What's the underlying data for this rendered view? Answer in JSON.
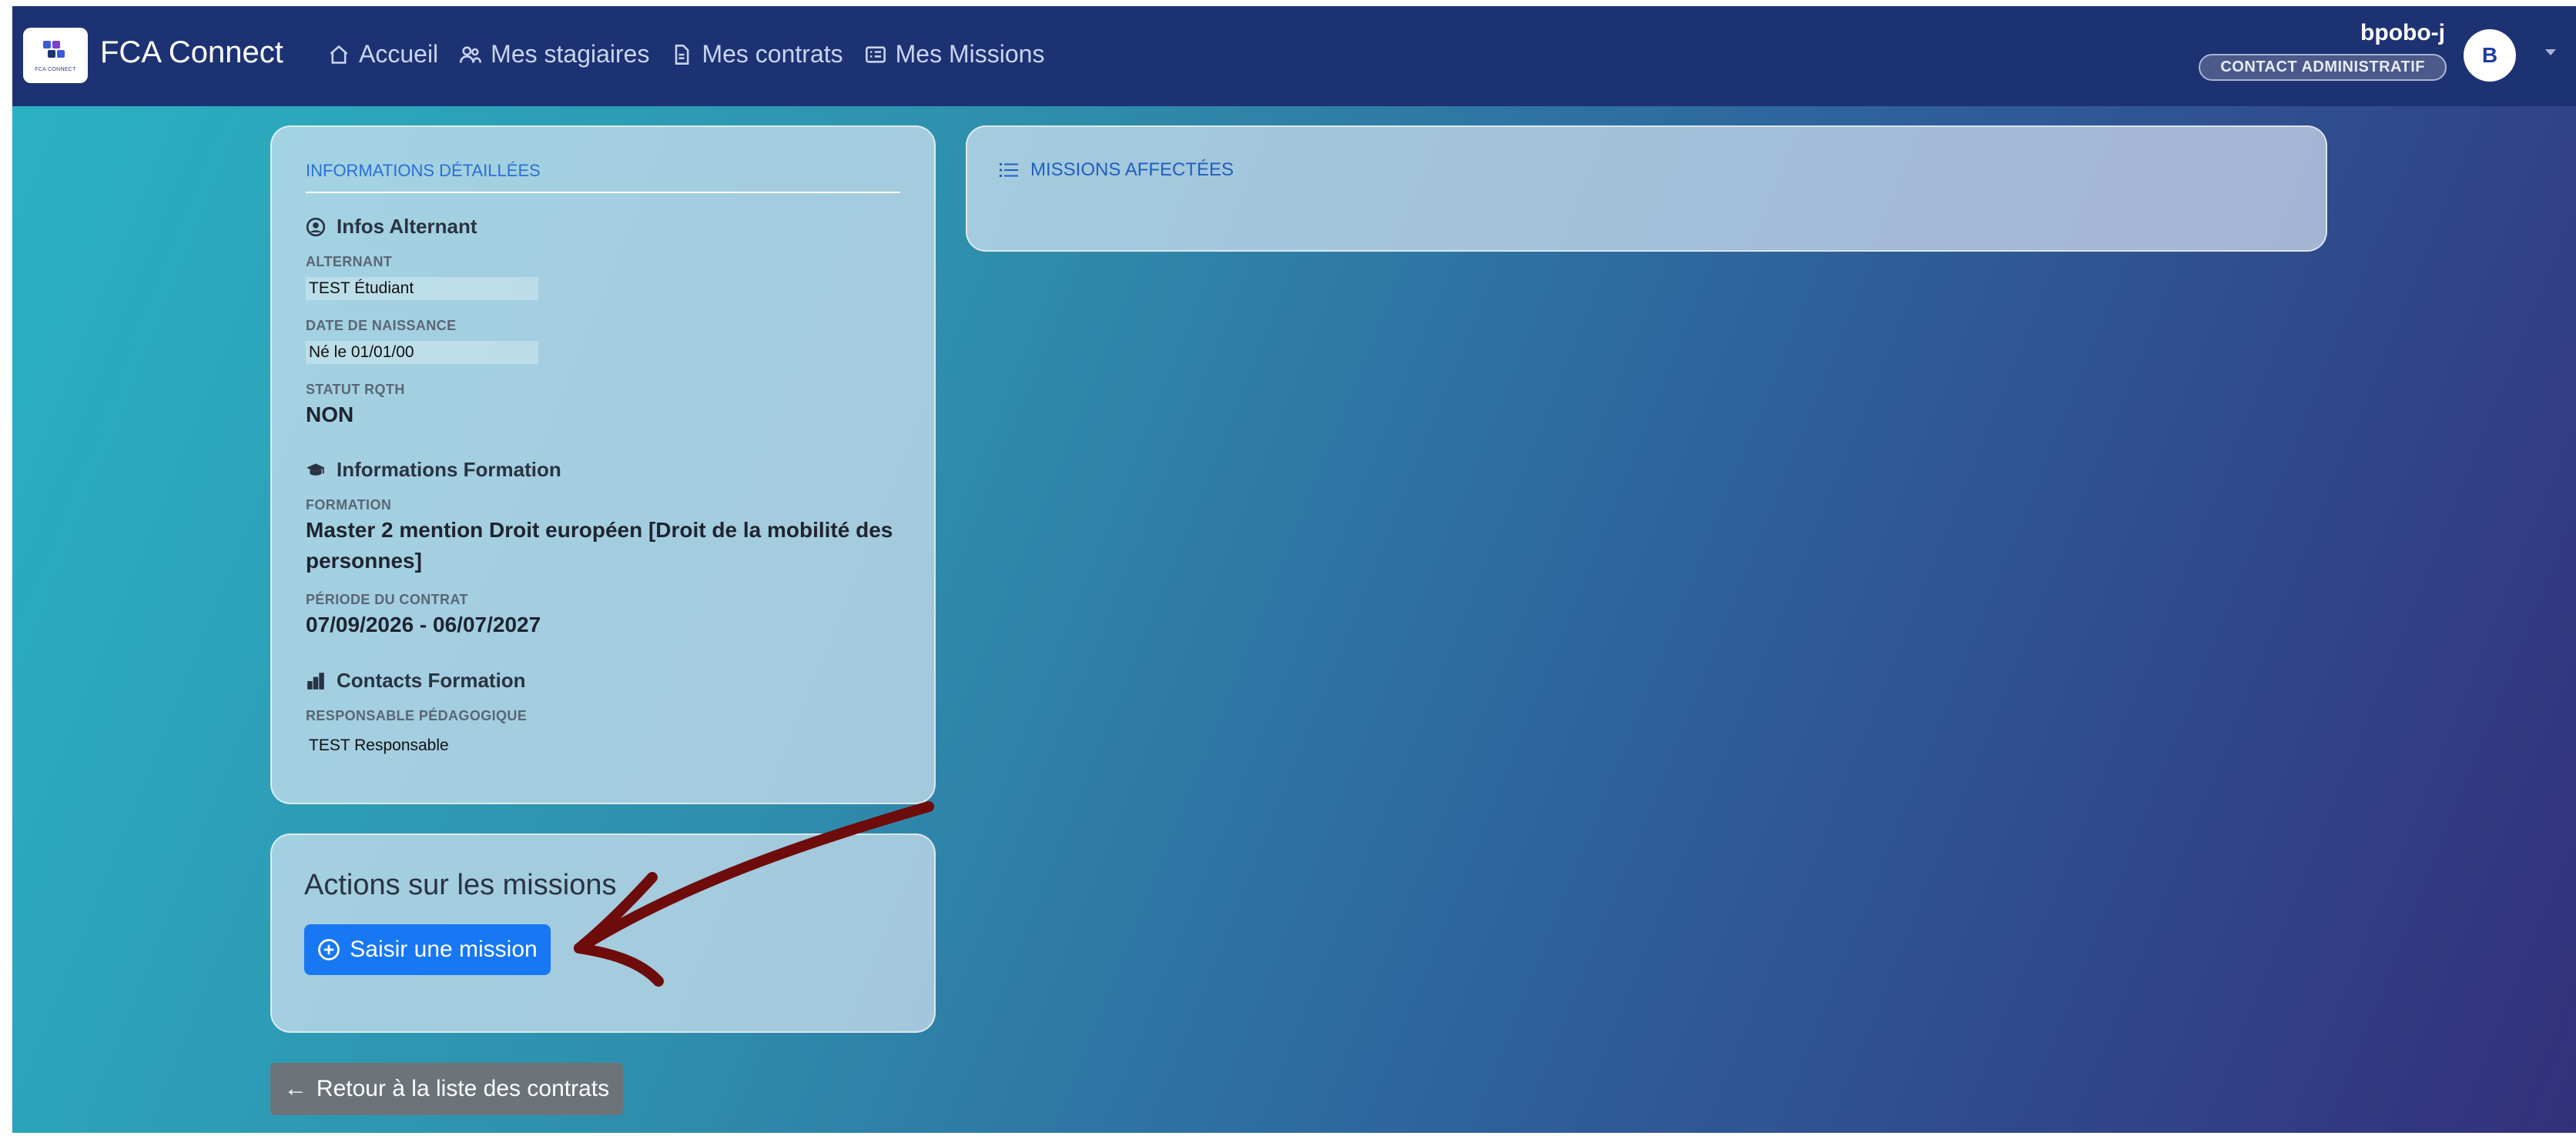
{
  "nav": {
    "logo_sub": "FCA CONNECT",
    "brand": "FCA Connect",
    "links": [
      {
        "label": "Accueil",
        "icon": "home-icon"
      },
      {
        "label": "Mes stagiaires",
        "icon": "users-icon"
      },
      {
        "label": "Mes contrats",
        "icon": "document-icon"
      },
      {
        "label": "Mes Missions",
        "icon": "list-card-icon"
      }
    ],
    "user": "bpobo-j",
    "role": "CONTACT ADMINISTRATIF",
    "avatar_letter": "B"
  },
  "info": {
    "header": "INFORMATIONS DÉTAILLÉES",
    "alternant": {
      "title": "Infos Alternant",
      "label_name": "ALTERNANT",
      "name": "TEST Étudiant",
      "label_birth": "DATE DE NAISSANCE",
      "birth": "Né le 01/01/00",
      "label_rqth": "STATUT RQTH",
      "rqth": "NON"
    },
    "formation": {
      "title": "Informations Formation",
      "label_formation": "FORMATION",
      "formation_line1": "Master 2 mention Droit européen [Droit de la mobilité des",
      "formation_line2": "personnes]",
      "label_period": "PÉRIODE DU CONTRAT",
      "period": "07/09/2026 - 06/07/2027"
    },
    "contacts": {
      "title": "Contacts Formation",
      "label_resp": "RESPONSABLE PÉDAGOGIQUE",
      "resp": "TEST Responsable"
    }
  },
  "missions": {
    "header": "MISSIONS AFFECTÉES"
  },
  "actions": {
    "title": "Actions sur les missions",
    "add_button": "Saisir une mission"
  },
  "back_button": "Retour à la liste des contrats",
  "colors": {
    "navbar": "#1d3273",
    "primary_button": "#1877f2",
    "annotation_arrow": "#6e0b0b"
  }
}
